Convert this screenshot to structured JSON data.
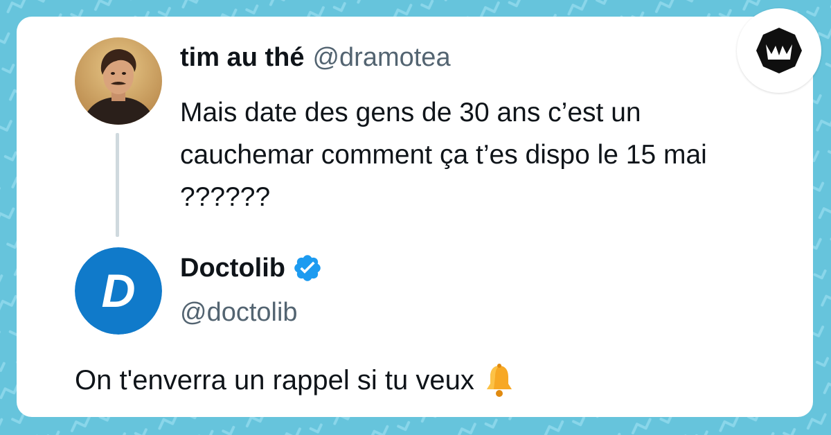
{
  "colors": {
    "background": "#66c4dc",
    "pattern": "#8ad6ea",
    "card": "#ffffff",
    "text": "#0f1419",
    "secondary_text": "#536471",
    "thread_line": "#cfd9de",
    "verified_blue": "#1d9bf0",
    "doctolib_blue": "#107ACA",
    "bell": "#f7a824"
  },
  "tweet": {
    "author": {
      "display_name": "tim au thé",
      "handle": "@dramotea"
    },
    "text": "Mais date des gens de 30 ans c’est un cauchemar comment ça t’es dispo le 15 mai ??????"
  },
  "reply": {
    "author": {
      "display_name": "Doctolib",
      "handle": "@doctolib",
      "verified": true,
      "avatar_letter": "D"
    },
    "text": "On t'enverra un rappel si tu veux",
    "emoji": "bell-icon"
  }
}
